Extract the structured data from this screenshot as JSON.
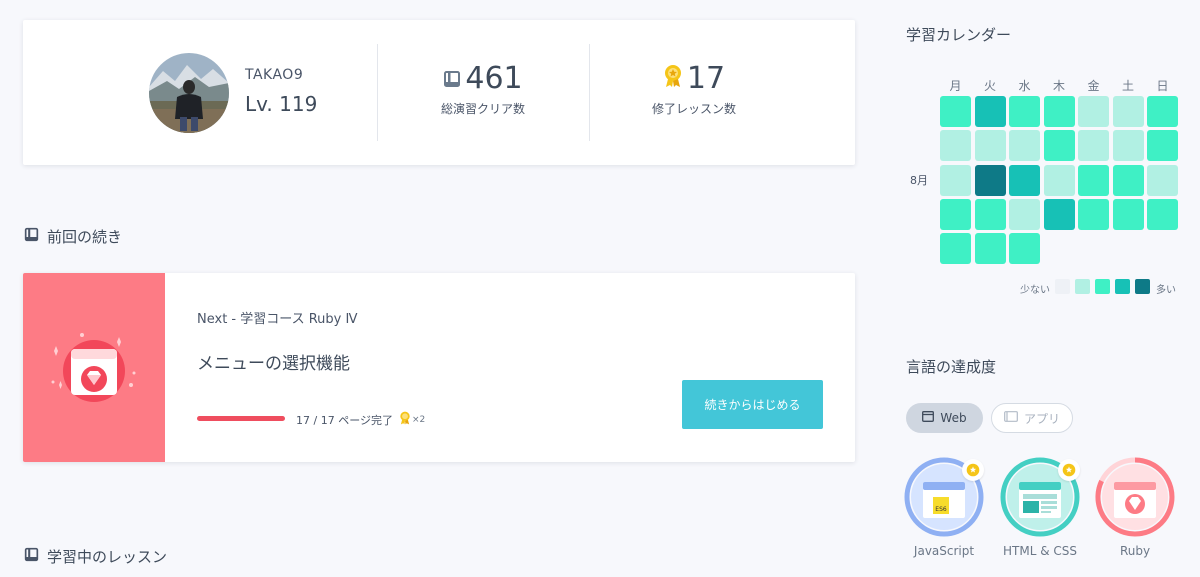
{
  "profile": {
    "username": "TAKAO9",
    "level": "Lv. 119",
    "exercises_count": "461",
    "exercises_label": "総演習クリア数",
    "lessons_count": "17",
    "lessons_label": "修了レッスン数"
  },
  "resume": {
    "section_title": "前回の続き",
    "next_label": "Next - 学習コース Ruby Ⅳ",
    "lesson_title": "メニューの選択機能",
    "progress_value": 1.0,
    "progress_text": "17 / 17 ページ完了",
    "medal_count": "×2",
    "button_label": "続きからはじめる"
  },
  "learning": {
    "section_title": "学習中のレッスン"
  },
  "calendar": {
    "title": "学習カレンダー",
    "weekdays": [
      "月",
      "火",
      "水",
      "木",
      "金",
      "土",
      "日"
    ],
    "month_label": "8月",
    "levels": [
      [
        2,
        3,
        2,
        2,
        1,
        1,
        2
      ],
      [
        1,
        1,
        1,
        2,
        1,
        1,
        2
      ],
      [
        1,
        4,
        3,
        1,
        2,
        2,
        1
      ],
      [
        2,
        2,
        1,
        3,
        2,
        2,
        2
      ],
      [
        2,
        2,
        2
      ]
    ],
    "level_colors": [
      "#eef1f6",
      "#b1f0e3",
      "#3ff0c5",
      "#17c1b6",
      "#0e7a87"
    ],
    "legend_less": "少ない",
    "legend_more": "多い"
  },
  "languages": {
    "title": "言語の達成度",
    "tabs": [
      {
        "label": "Web",
        "active": true
      },
      {
        "label": "アプリ",
        "active": false
      }
    ],
    "items": [
      {
        "name": "JavaScript",
        "ring_color": "#8fb0f3",
        "completed": true
      },
      {
        "name": "HTML & CSS",
        "ring_color": "#44cfc3",
        "completed": true
      },
      {
        "name": "Ruby",
        "ring_color": "#fd7b85",
        "completed": false
      }
    ]
  }
}
